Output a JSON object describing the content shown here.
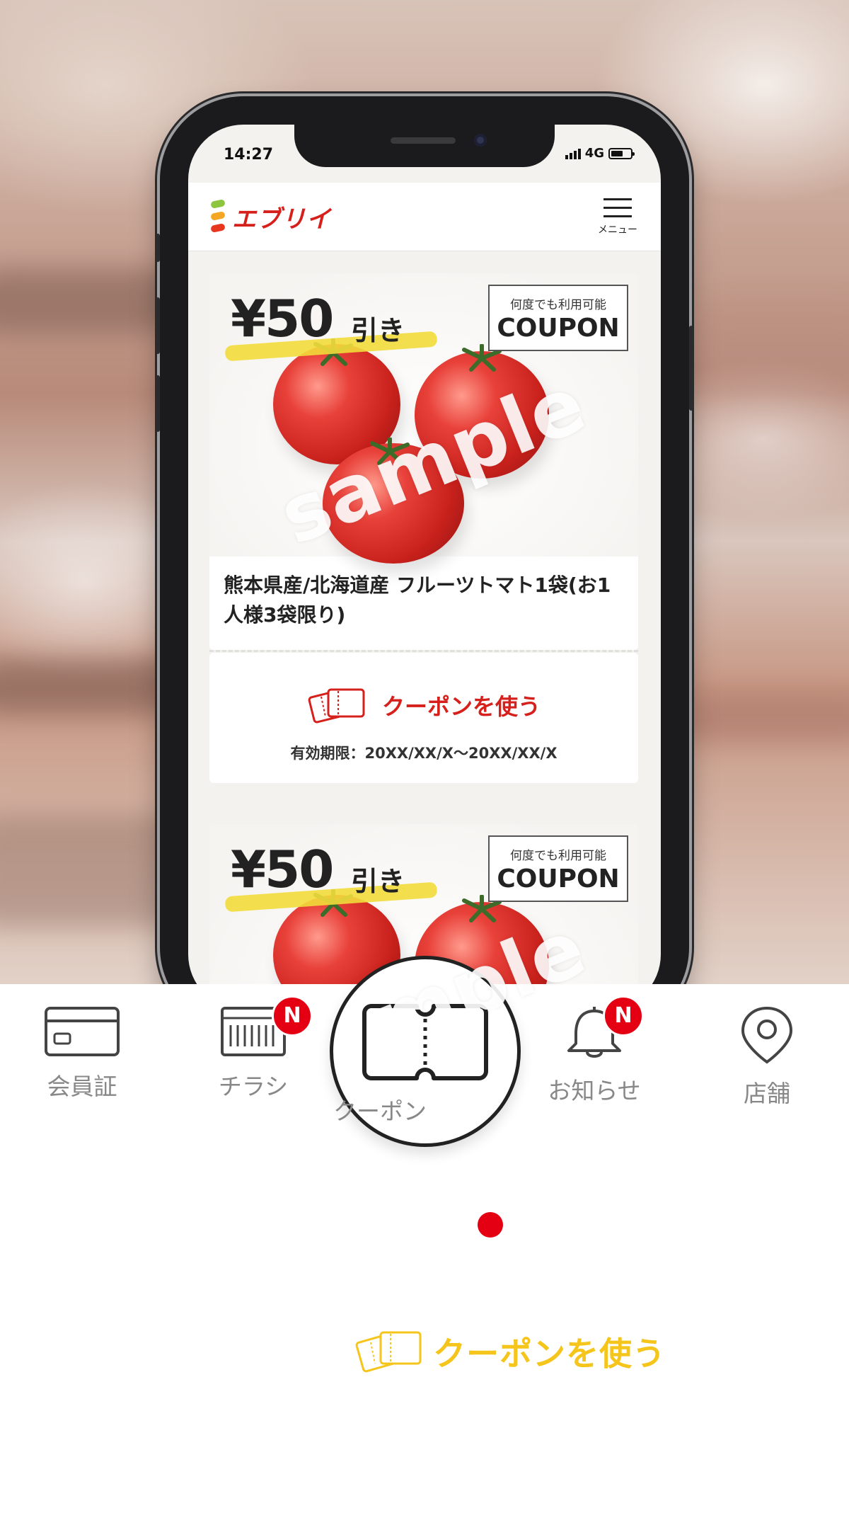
{
  "status_bar": {
    "time": "14:27",
    "network": "4G"
  },
  "header": {
    "logo_text": "エブリイ",
    "menu_label": "メニュー"
  },
  "coupons": [
    {
      "price": "¥50",
      "price_suffix": "引き",
      "badge_top": "何度でも利用可能",
      "badge_main": "COUPON",
      "watermark": "sample",
      "product_name": "熊本県産/北海道産 フルーツトマト1袋(お1人様3袋限り)",
      "use_label": "クーポンを使う",
      "validity": "有効期限：20XX/XX/X～20XX/XX/X"
    },
    {
      "price": "¥50",
      "price_suffix": "引き",
      "badge_top": "何度でも利用可能",
      "badge_main": "COUPON",
      "watermark": "sample"
    }
  ],
  "bottom_nav": {
    "items": [
      {
        "label": "会員証",
        "icon": "member-card-icon"
      },
      {
        "label": "チラシ",
        "icon": "flyer-icon",
        "badge": "N"
      },
      {
        "label": "クーポン",
        "icon": "coupon-ticket-icon",
        "active": true
      },
      {
        "label": "お知らせ",
        "icon": "bell-icon",
        "badge": "N"
      },
      {
        "label": "店舗",
        "icon": "location-pin-icon"
      }
    ]
  },
  "floating_use": {
    "label": "クーポンを使う"
  },
  "colors": {
    "brand_red": "#d6201c",
    "badge_red": "#e40012",
    "yellow": "#f5c51b"
  }
}
